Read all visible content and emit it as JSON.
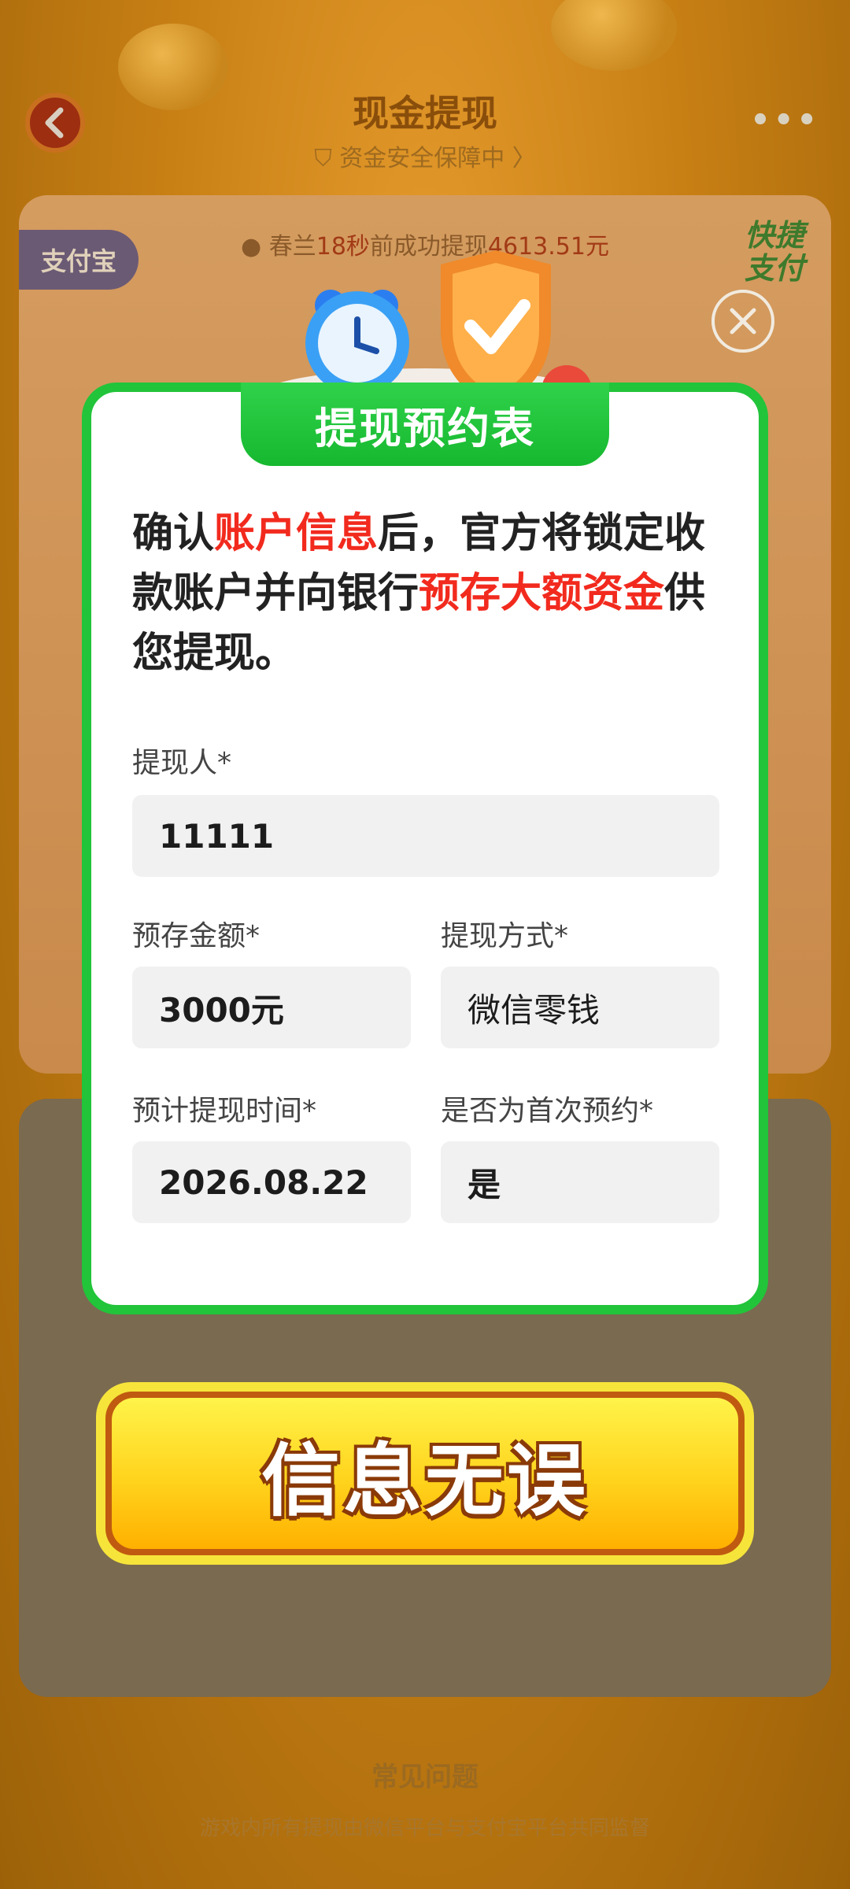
{
  "header": {
    "title": "现金提现",
    "safety_text": "资金安全保障中",
    "more_label": "•••"
  },
  "ticker": {
    "name": "春兰",
    "highlight_time": "18秒",
    "middle": "前成功提现",
    "amount": "4613.51元"
  },
  "badges": {
    "alipay": "支付宝",
    "fast_pay_line1": "快捷",
    "fast_pay_line2": "支付"
  },
  "modal": {
    "title": "提现预约表",
    "intro": {
      "part1": "确认",
      "red1": "账户信息",
      "part2": "后，官方将锁定收款账户并向银行",
      "red2": "预存大额资金",
      "part3": "供您提现。"
    },
    "fields": {
      "withdrawer": {
        "label": "提现人*",
        "value": "11111"
      },
      "deposit_amount": {
        "label": "预存金额*",
        "value": "3000元"
      },
      "method": {
        "label": "提现方式*",
        "value": "微信零钱"
      },
      "time": {
        "label": "预计提现时间*",
        "value": "2026.08.22"
      },
      "first_time": {
        "label": "是否为首次预约*",
        "value": "是"
      }
    }
  },
  "confirm_button": {
    "label": "信息无误"
  },
  "faq": {
    "title": "常见问题",
    "subtitle": "游戏内所有提现由微信平台与支付宝平台共同监督"
  },
  "colors": {
    "green_border": "#22c43a",
    "highlight_red": "#f22a1e",
    "button_yellow": "#ffd31c"
  }
}
